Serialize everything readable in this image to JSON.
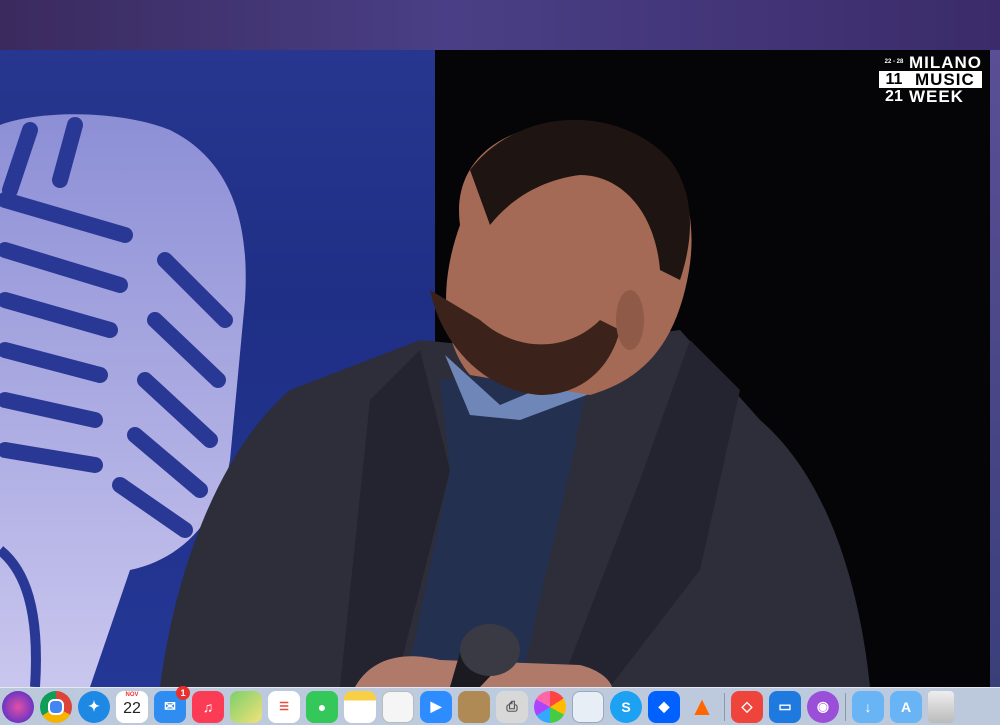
{
  "logo": {
    "dates": "22 - 28",
    "month": "11",
    "year": "21",
    "line1": "MILANO",
    "line2": "MUSIC",
    "line3": "WEEK"
  },
  "dock": {
    "calendar_month": "NOV",
    "calendar_day": "22",
    "mail_badge": "1",
    "items": [
      "siri-icon",
      "chrome-icon",
      "safari-icon",
      "calendar-icon",
      "mail-icon",
      "music-icon",
      "maps-icon",
      "reminders-icon",
      "messages-icon",
      "notes-icon",
      "textedit-icon",
      "zoom-icon",
      "contacts-icon",
      "printer-icon",
      "photos-icon",
      "preview-icon",
      "skype-icon",
      "dropbox-icon",
      "vlc-icon",
      "anydesk-icon",
      "keynote-icon",
      "podcasts-icon",
      "downloads-folder-icon",
      "applications-folder-icon",
      "trash-icon"
    ]
  },
  "colors": {
    "backdrop": "#27368e",
    "stage": "#050507",
    "dock": "#c8d7e6"
  }
}
